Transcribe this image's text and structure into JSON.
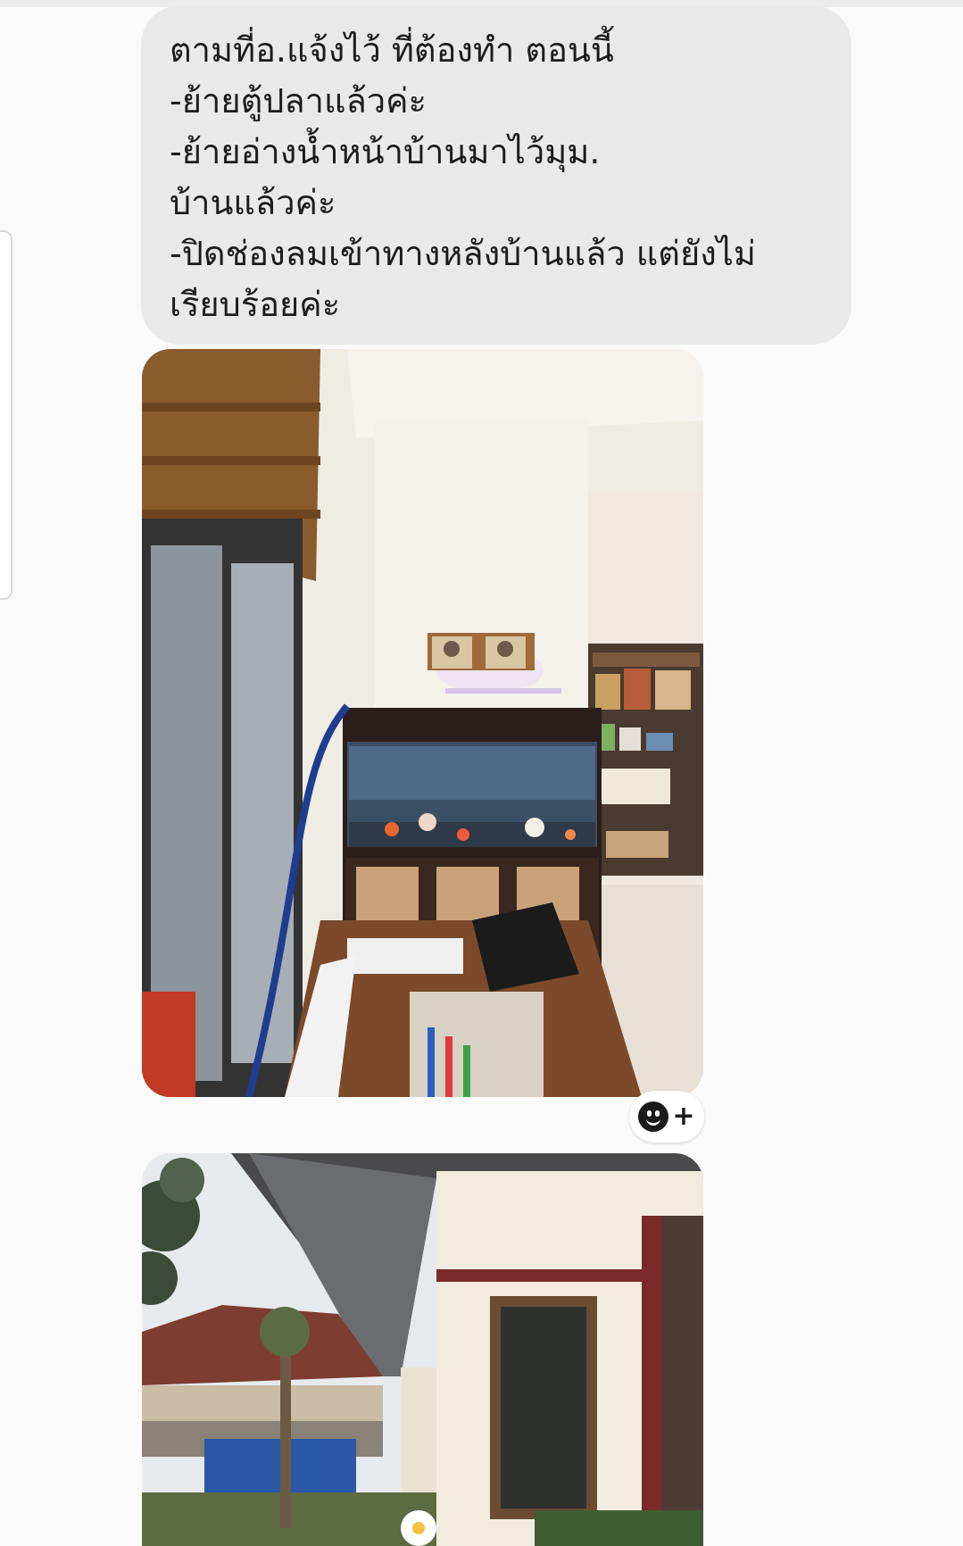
{
  "message": {
    "lines": [
      "ตามที่อ.แจ้งไว้ ที่ต้องทำ ตอนนี้",
      "-ย้ายตู้ปลาแล้วค่ะ",
      "-ย้ายอ่างน้ำหน้าบ้านมาไว้มุม.",
      "บ้านแล้วค่ะ",
      "-ปิดช่องลมเข้าทางหลังบ้านแล้ว แต่ยังไม่",
      "เรียบร้อยค่ะ"
    ]
  },
  "photos": [
    {
      "subject": "aquarium-corner"
    },
    {
      "subject": "house-exterior"
    }
  ],
  "reaction": {
    "icon": "smiley-icon",
    "add_icon": "plus-icon"
  },
  "colors": {
    "bubble": "#e9e9e9",
    "text": "#1c1c1c",
    "background": "#fafafa"
  }
}
